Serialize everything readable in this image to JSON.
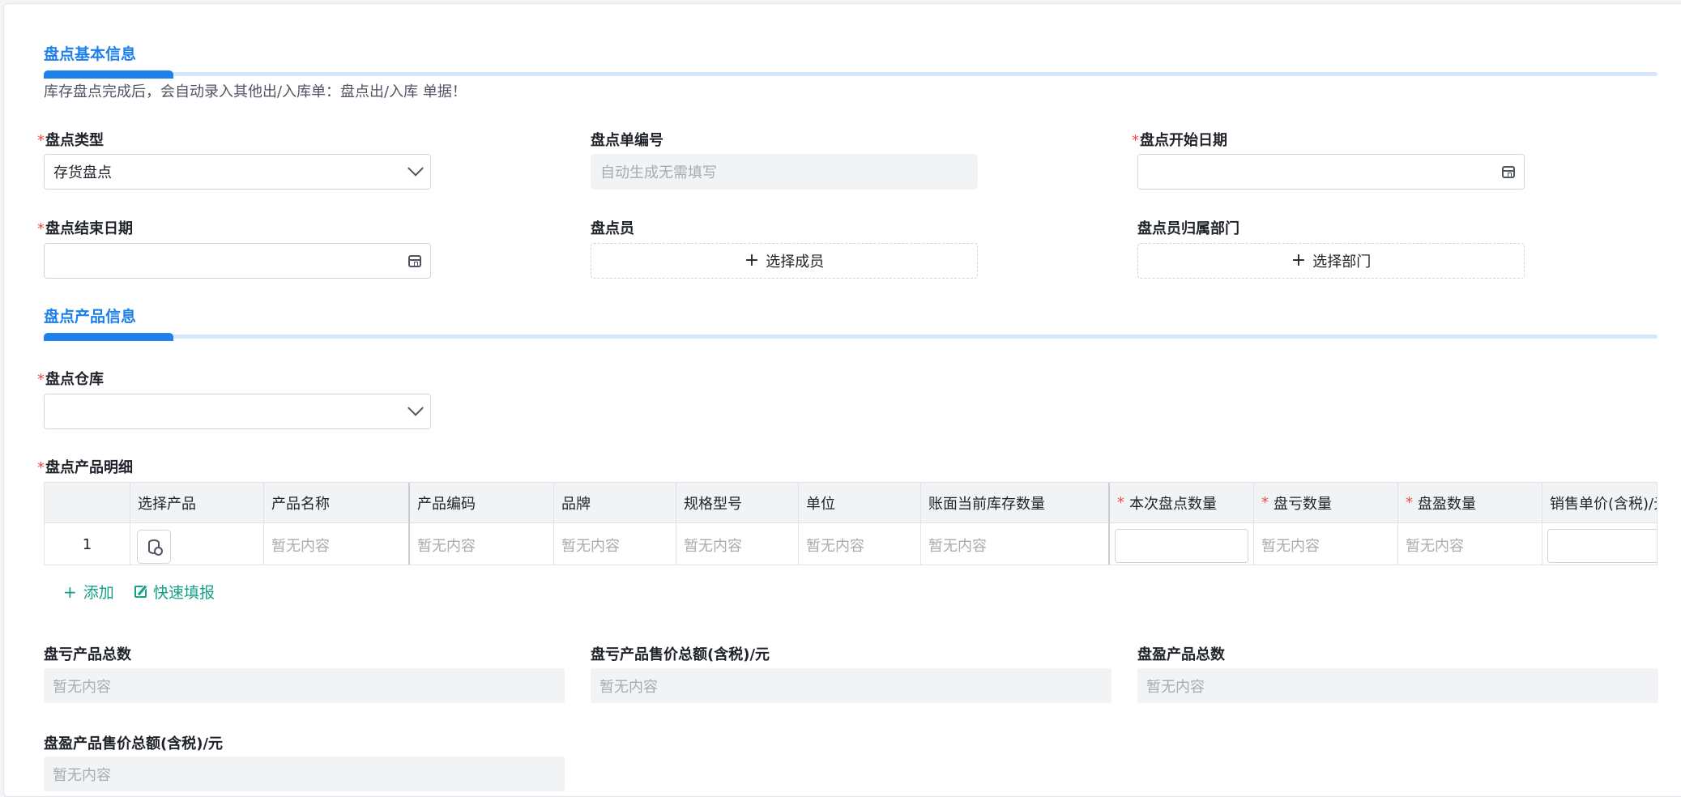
{
  "sections": {
    "basic": "盘点基本信息",
    "notice": "库存盘点完成后，会自动录入其他出/入库单：盘点出/入库 单据！",
    "product": "盘点产品信息"
  },
  "required_mark": "*",
  "fields": {
    "type_label": "盘点类型",
    "type_value": "存货盘点",
    "order_no_label": "盘点单编号",
    "order_no_placeholder": "自动生成无需填写",
    "start_date_label": "盘点开始日期",
    "end_date_label": "盘点结束日期",
    "member_label": "盘点员",
    "member_button": "选择成员",
    "dept_label": "盘点员归属部门",
    "dept_button": "选择部门",
    "warehouse_label": "盘点仓库",
    "detail_label": "盘点产品明细"
  },
  "table": {
    "headers": [
      "选择产品",
      "产品名称",
      "产品编码",
      "品牌",
      "规格型号",
      "单位",
      "账面当前库存数量",
      "本次盘点数量",
      "盘亏数量",
      "盘盈数量",
      "销售单价(含税)/元"
    ],
    "required_headers_mark": "*",
    "row_index": "1",
    "empty": "暂无内容"
  },
  "actions": {
    "add": "添加",
    "quick_fill": "快速填报"
  },
  "summary": {
    "loss_count_label": "盘亏产品总数",
    "loss_amount_label": "盘亏产品售价总额(含税)/元",
    "gain_count_label": "盘盈产品总数",
    "gain_amount_label": "盘盈产品售价总额(含税)/元",
    "empty": "暂无内容"
  },
  "colors": {
    "accent": "#1e80ea",
    "required": "#f54a45",
    "link": "#16a085"
  }
}
